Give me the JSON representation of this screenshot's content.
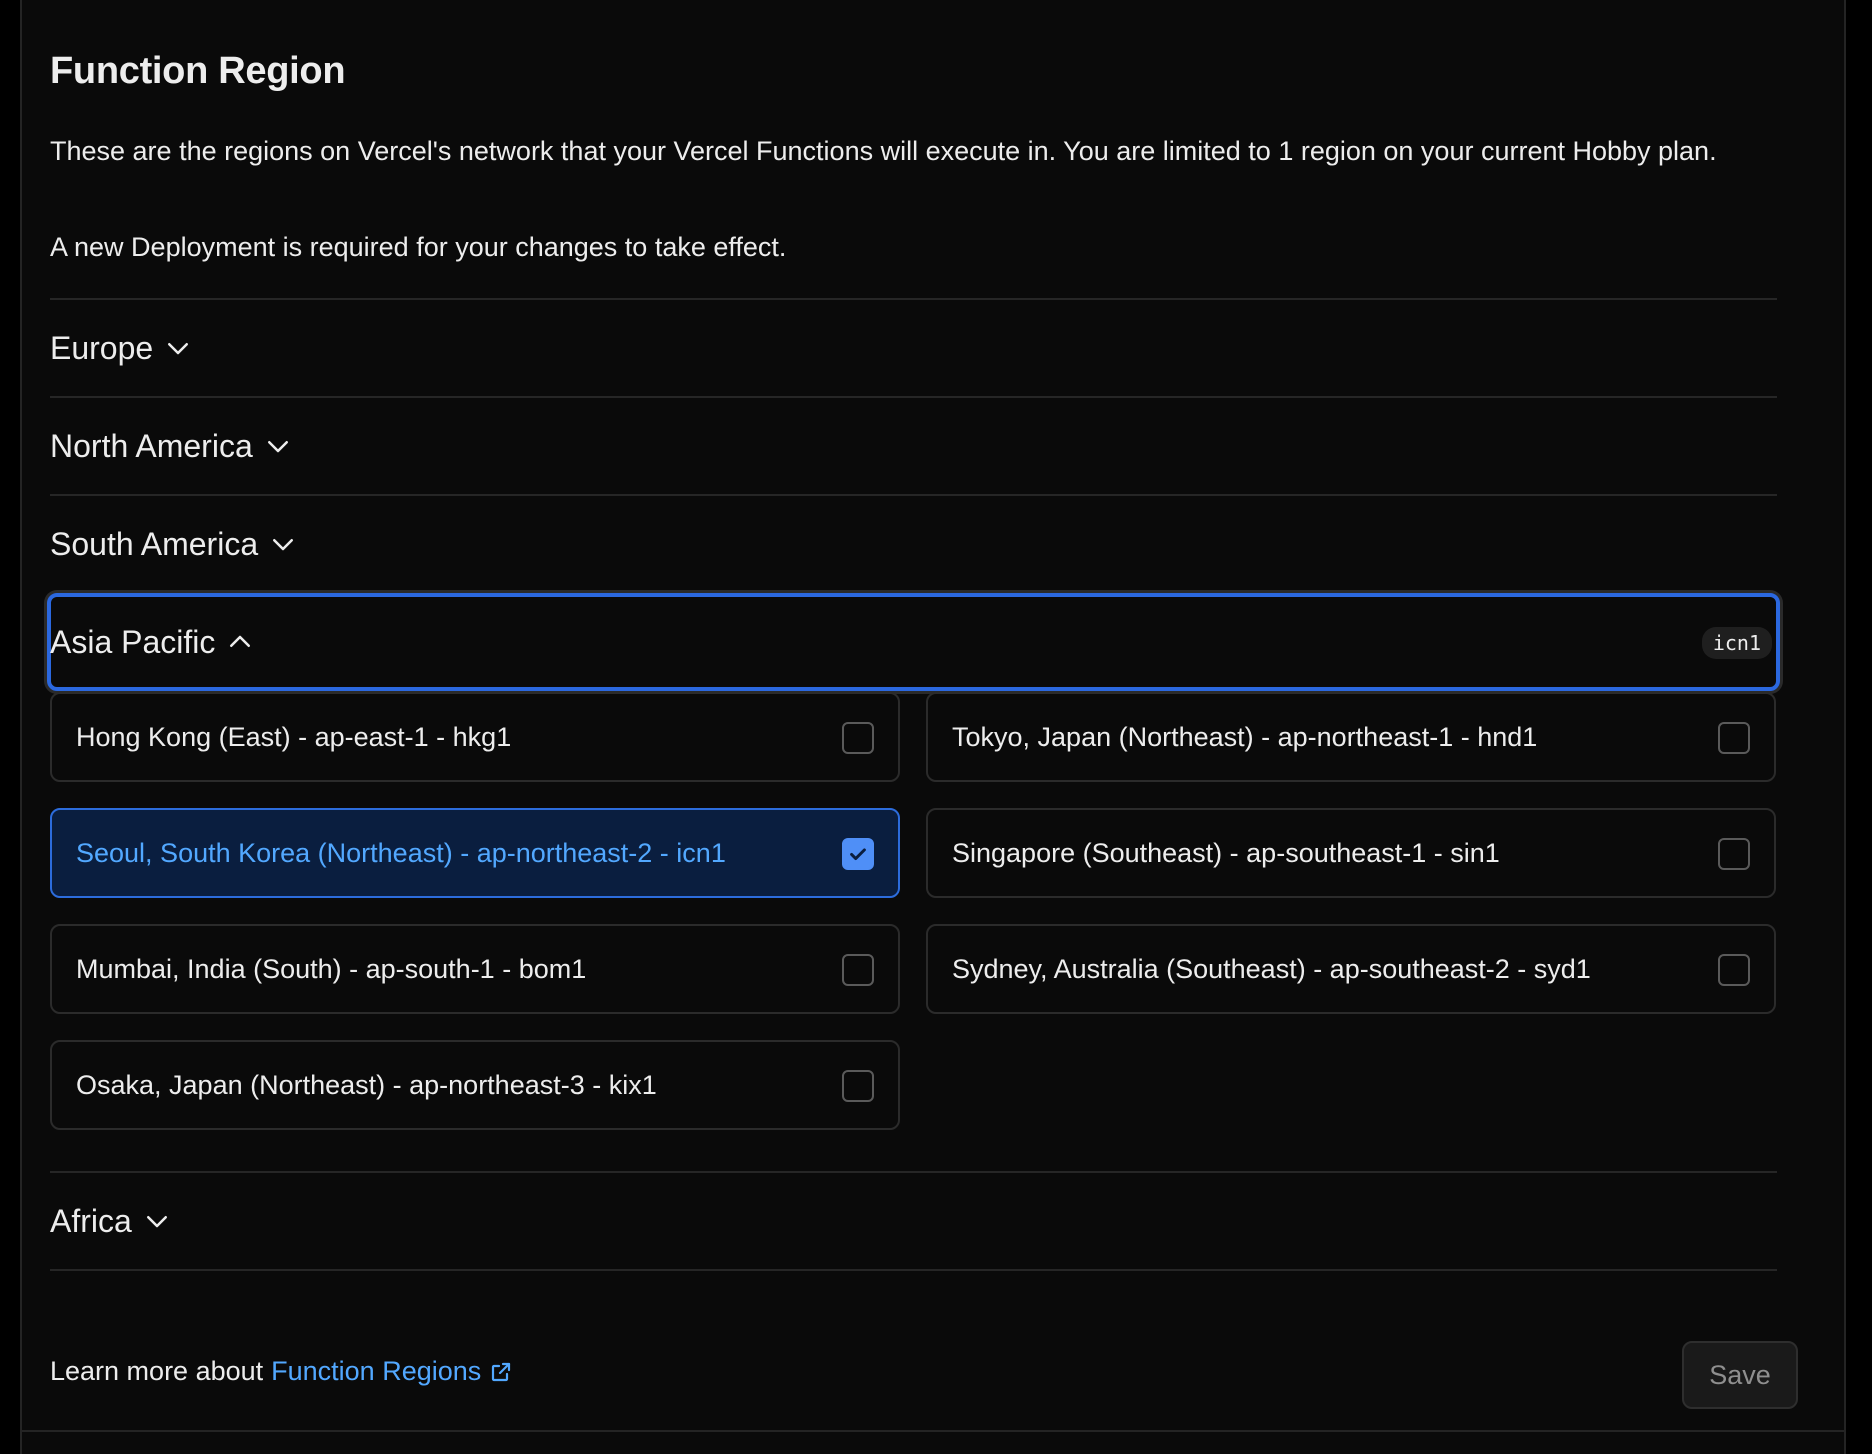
{
  "section": {
    "title": "Function Region",
    "description": "These are the regions on Vercel's network that your Vercel Functions will execute in. You are limited to 1 region on your current Hobby plan.",
    "note": "A new Deployment is required for your changes to take effect."
  },
  "regions": {
    "europe": {
      "label": "Europe",
      "expanded": false
    },
    "north_america": {
      "label": "North America",
      "expanded": false
    },
    "south_america": {
      "label": "South America",
      "expanded": false
    },
    "asia_pacific": {
      "label": "Asia Pacific",
      "expanded": true,
      "badge": "icn1",
      "options": [
        {
          "label": "Hong Kong (East) - ap-east-1 - hkg1",
          "checked": false
        },
        {
          "label": "Tokyo, Japan (Northeast) - ap-northeast-1 - hnd1",
          "checked": false
        },
        {
          "label": "Seoul, South Korea (Northeast) - ap-northeast-2 - icn1",
          "checked": true
        },
        {
          "label": "Singapore (Southeast) - ap-southeast-1 - sin1",
          "checked": false
        },
        {
          "label": "Mumbai, India (South) - ap-south-1 - bom1",
          "checked": false
        },
        {
          "label": "Sydney, Australia (Southeast) - ap-southeast-2 - syd1",
          "checked": false
        },
        {
          "label": "Osaka, Japan (Northeast) - ap-northeast-3 - kix1",
          "checked": false
        }
      ]
    },
    "africa": {
      "label": "Africa",
      "expanded": false
    }
  },
  "footer": {
    "learn_more_prefix": "Learn more about",
    "learn_more_link": "Function Regions",
    "save_label": "Save"
  },
  "colors": {
    "accent": "#2b68df",
    "link": "#52a8ff",
    "selected_bg": "#0a1e3f",
    "background": "#0a0a0a"
  }
}
